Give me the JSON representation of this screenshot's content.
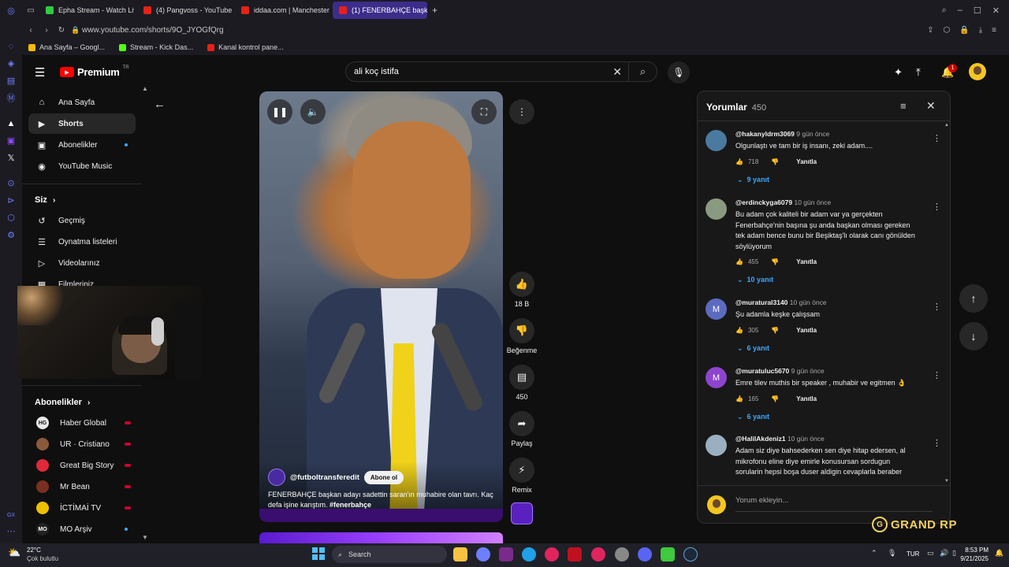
{
  "browser": {
    "tabs": [
      {
        "label": "Epha Stream - Watch Live",
        "color": "#2ecc40"
      },
      {
        "label": "(4) Pangvoss - YouTube",
        "color": "#e62117"
      },
      {
        "label": "iddaa.com | Manchester",
        "color": "#e62117"
      },
      {
        "label": "(1) FENERBAHÇE başk",
        "color": "#e62117",
        "active": true
      }
    ],
    "new_tab": "+",
    "url": "www.youtube.com/shorts/9O_JYOGfQrg",
    "bookmarks": [
      "Ana Sayfa – Googl...",
      "Stream - Kick Das...",
      "Kanal kontrol pane..."
    ]
  },
  "youtube": {
    "logo": "Premium",
    "logo_region": "TR",
    "search_value": "ali koç istifa",
    "notification_count": "1"
  },
  "sidebar": {
    "main": [
      {
        "label": "Ana Sayfa",
        "icon": "home-icon"
      },
      {
        "label": "Shorts",
        "icon": "shorts-icon",
        "active": true
      },
      {
        "label": "Abonelikler",
        "icon": "subscriptions-icon"
      },
      {
        "label": "YouTube Music",
        "icon": "music-icon"
      }
    ],
    "you_header": "Siz",
    "you": [
      {
        "label": "Geçmiş",
        "icon": "history-icon"
      },
      {
        "label": "Oynatma listeleri",
        "icon": "playlist-icon"
      },
      {
        "label": "Videolarınız",
        "icon": "video-icon"
      },
      {
        "label": "Filmleriniz",
        "icon": "film-icon"
      }
    ],
    "subs_header": "Abonelikler",
    "subscriptions": [
      {
        "label": "Haber Global",
        "badge": "HG",
        "color": "#e8e8e8"
      },
      {
        "label": "UR · Cristiano",
        "badge": "",
        "color": "#8a5a3a"
      },
      {
        "label": "Great Big Story",
        "badge": "",
        "color": "#e0283a"
      },
      {
        "label": "Mr Bean",
        "badge": "",
        "color": "#7a3020"
      },
      {
        "label": "İCTİMAİ TV",
        "badge": "",
        "color": "#f0c000"
      },
      {
        "label": "MO Arşiv",
        "badge": "MO",
        "color": "#222"
      }
    ]
  },
  "short": {
    "channel": "@futboltransferedit",
    "subscribe": "Abone ol",
    "caption": "FENERBAHÇE başkan adayı sadettin saran'ın muhabire olan tavrı. Kaç defa işine karıştım. ",
    "hashtag": "#fenerbahçe",
    "actions": {
      "likes": "18 B",
      "dislike": "Beğenme",
      "comments": "450",
      "share": "Paylaş",
      "remix": "Remix"
    }
  },
  "comments": {
    "title": "Yorumlar",
    "count": "450",
    "reply_label": "Yanıtla",
    "add_placeholder": "Yorum ekleyin...",
    "items": [
      {
        "author": "@hakanyldrm3069",
        "time": "9 gün önce",
        "text": "Olgunlaştı ve tam bir iş insanı, zeki adam....",
        "likes": "718",
        "replies": "9 yanıt",
        "avatar": "",
        "color": "#4a7aa0"
      },
      {
        "author": "@erdinckyga6079",
        "time": "10 gün önce",
        "text": "Bu adam çok kaliteli bir adam var ya gerçekten Fenerbahçe'nin başına şu anda başkan olması gereken tek adam bence bunu bir Beşiktaş'lı olarak canı gönülden söylüyorum",
        "likes": "455",
        "replies": "10 yanıt",
        "avatar": "",
        "color": "#8a9a80"
      },
      {
        "author": "@muratural3140",
        "time": "10 gün önce",
        "text": "Şu adamla keşke çalışsam",
        "likes": "305",
        "replies": "6 yanıt",
        "avatar": "M",
        "color": "#5c6bc0"
      },
      {
        "author": "@muratuluc5670",
        "time": "9 gün önce",
        "text": "Emre tilev muthis bir speaker , muhabir ve egitmen 👌",
        "likes": "165",
        "replies": "6 yanıt",
        "avatar": "M",
        "color": "#8e44cf"
      },
      {
        "author": "@HalilAkdeniz1",
        "time": "10 gün önce",
        "text": "Adam siz diye bahsederken sen diye hitap edersen, al mikrofonu eline diye emirle konusursan sordugun sorularin hepsi boşa duser aldigin cevaplarla beraber",
        "likes": "",
        "replies": "",
        "avatar": "",
        "color": "#9ab0c0"
      }
    ]
  },
  "overlay": {
    "brand": "GRAND RP"
  },
  "taskbar": {
    "weather_temp": "22°C",
    "weather_desc": "Çok bulutlu",
    "search": "Search",
    "lang": "TUR",
    "time": "8:53 PM",
    "date": "9/21/2025"
  }
}
